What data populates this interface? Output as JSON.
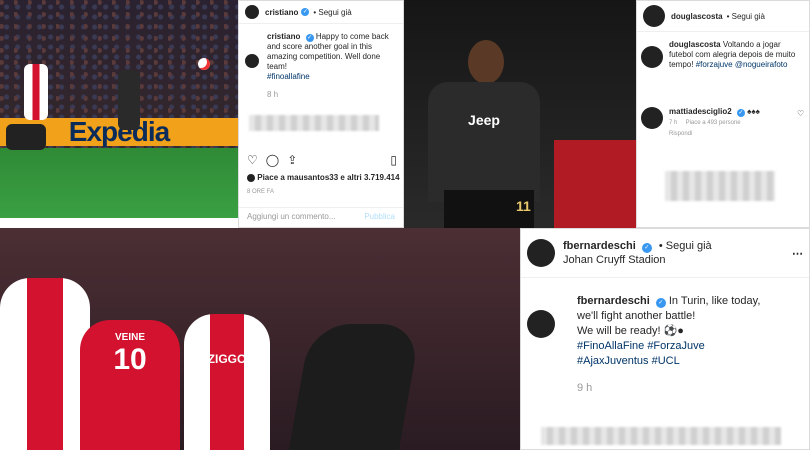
{
  "colors": {
    "ig_blue": "#3897f0",
    "hashtag": "#003569",
    "ajax_red": "#d2122e",
    "juve_black": "#1c1c1c"
  },
  "top_left_photo": {
    "adboard_text": "Expedia"
  },
  "cristiano_post": {
    "username": "cristiano",
    "follow_label": "Segui già",
    "caption_user": "cristiano",
    "caption_text": "Happy to come back and score another goal in this amazing competition. Well done team!",
    "caption_tag": "#finoallafine",
    "time": "8 h",
    "likes_text": "Piace a mausantos33 e altri 3.719.414",
    "age": "8 ORE FA",
    "comment_placeholder": "Aggiungi un commento...",
    "publish_label": "Pubblica"
  },
  "douglas_photo": {
    "badge_text": "Jeep",
    "number": "11"
  },
  "douglas_post": {
    "username": "douglascosta",
    "follow_label": "Segui già",
    "caption_user": "douglascosta",
    "caption_text": "Voltando a jogar futebol com alegria depois de muito tempo!",
    "caption_tags": "#forzajuve @nogueirafoto",
    "comment_user": "mattiadesciglio2",
    "comment_text": "♠♠♠",
    "comment_time": "7 h",
    "comment_likes": "Piace a 493 persone",
    "reply_label": "Rispondi"
  },
  "bottom_photo": {
    "ajax_sponsor": "ZIGGO",
    "back_name": "VEINE",
    "back_number": "10"
  },
  "bernardeschi_post": {
    "username": "fbernardeschi",
    "follow_label": "Segui già",
    "location": "Johan Cruyff Stadion",
    "caption_user": "fbernardeschi",
    "caption_line1": "In Turin, like today,",
    "caption_line2": "we'll fight another battle!",
    "caption_line3": "We will be ready! ⚽️●",
    "caption_tags1": "#FinoAllaFine #ForzaJuve",
    "caption_tags2": "#AjaxJuventus #UCL",
    "time": "9 h"
  }
}
